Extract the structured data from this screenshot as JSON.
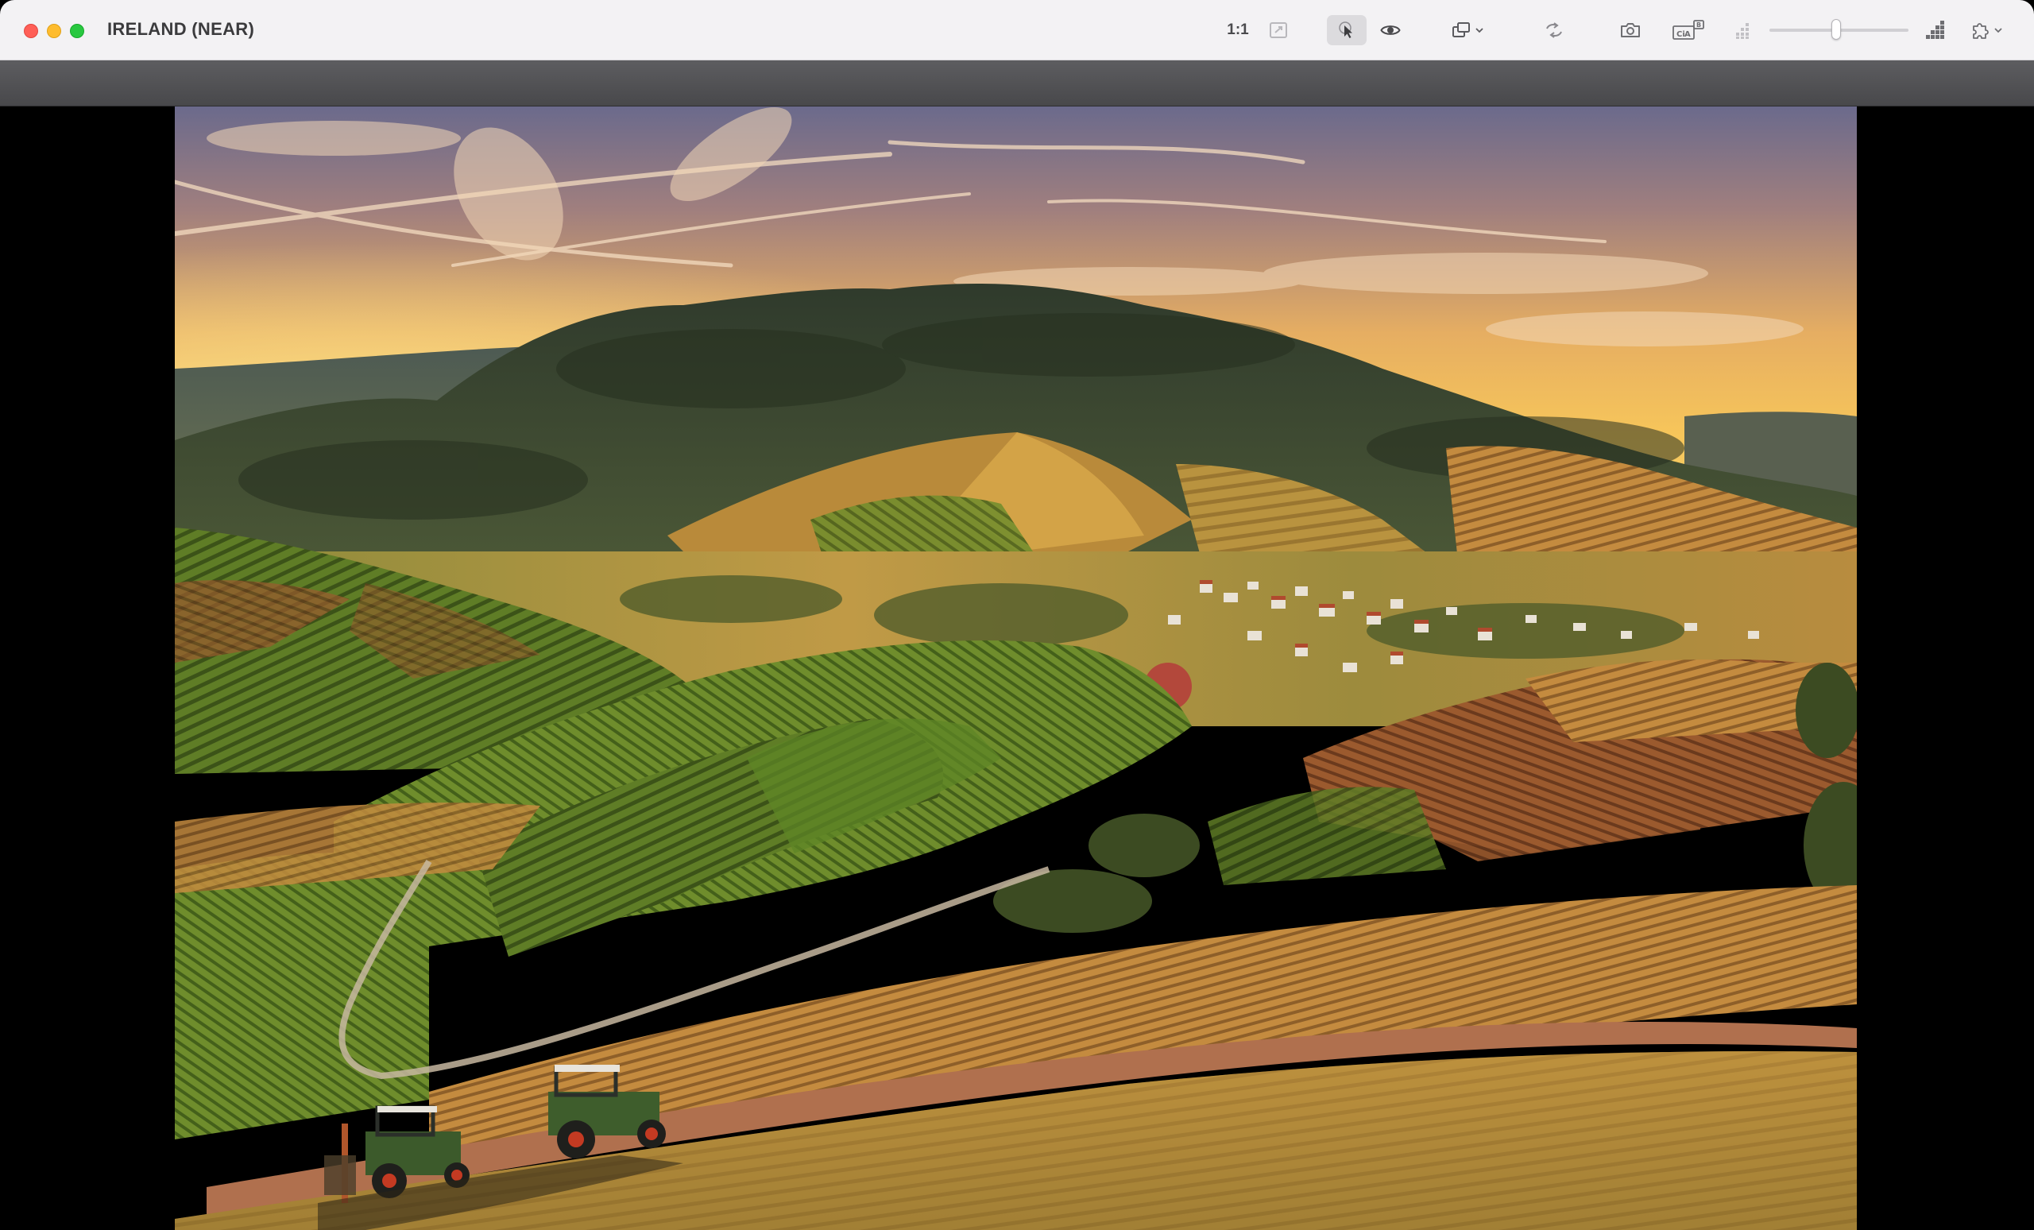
{
  "window": {
    "title": "IRELAND (NEAR)"
  },
  "toolbar": {
    "zoom_label": "1:1",
    "icons": [
      "fit-to-window-icon",
      "select-cursor-icon",
      "preview-eye-icon",
      "window-arrange-icon",
      "flip-arrows-icon",
      "camera-icon",
      "compare-ab-icon",
      "size-small-icon",
      "size-large-icon",
      "plugins-puzzle-icon"
    ],
    "slider_level": 0.48
  },
  "image": {
    "subject": "landscape-photo",
    "colors": {
      "sky_top": "#6f6a8e",
      "sky_glow": "#f6c15a",
      "hills_dark": "#3f4a36",
      "vineyard_green": "#6f8a2e",
      "vineyard_gold": "#c79a45",
      "foreground": "#b08a3c"
    }
  }
}
